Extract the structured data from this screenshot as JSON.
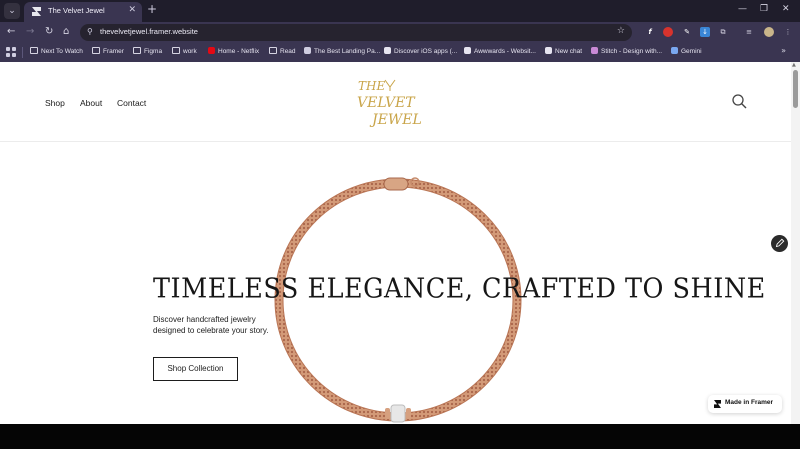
{
  "browser": {
    "tab_title": "The Velvet Jewel",
    "url": "thevelvetjewel.framer.website",
    "new_tab_symbol": "+",
    "tab_close_symbol": "✕",
    "bookmarks": [
      {
        "label": "Next To Watch",
        "icon": "folder-icon"
      },
      {
        "label": "Framer",
        "icon": "folder-icon"
      },
      {
        "label": "Figma",
        "icon": "folder-icon"
      },
      {
        "label": "work",
        "icon": "folder-icon"
      },
      {
        "label": "Home - Netflix",
        "icon": "netflix-icon"
      },
      {
        "label": "Read",
        "icon": "folder-icon"
      },
      {
        "label": "The Best Landing Pa...",
        "icon": "site-icon"
      },
      {
        "label": "Discover iOS apps (...",
        "icon": "cloud-icon"
      },
      {
        "label": "Awwwards - Websit...",
        "icon": "awwwards-icon"
      },
      {
        "label": "New chat",
        "icon": "openai-icon"
      },
      {
        "label": "Stitch - Design with...",
        "icon": "stitch-icon"
      },
      {
        "label": "Gemini",
        "icon": "gemini-icon"
      }
    ],
    "colors": {
      "frame": "#1f1d2b",
      "toolbar": "#3a3551",
      "omnibox": "#26232f"
    }
  },
  "site": {
    "nav": {
      "shop": "Shop",
      "about": "About",
      "contact": "Contact"
    },
    "logo": {
      "line1": "THE",
      "line2": "VELVET",
      "line3": "JEWEL",
      "color": "#c9a54a"
    },
    "hero": {
      "title": "TIMELESS ELEGANCE, CRAFTED TO SHINE",
      "subtitle": "Discover handcrafted jewelry designed to celebrate your story.",
      "cta": "Shop Collection"
    },
    "badge": "Made in Framer",
    "necklace_color": "#c98a6a"
  }
}
